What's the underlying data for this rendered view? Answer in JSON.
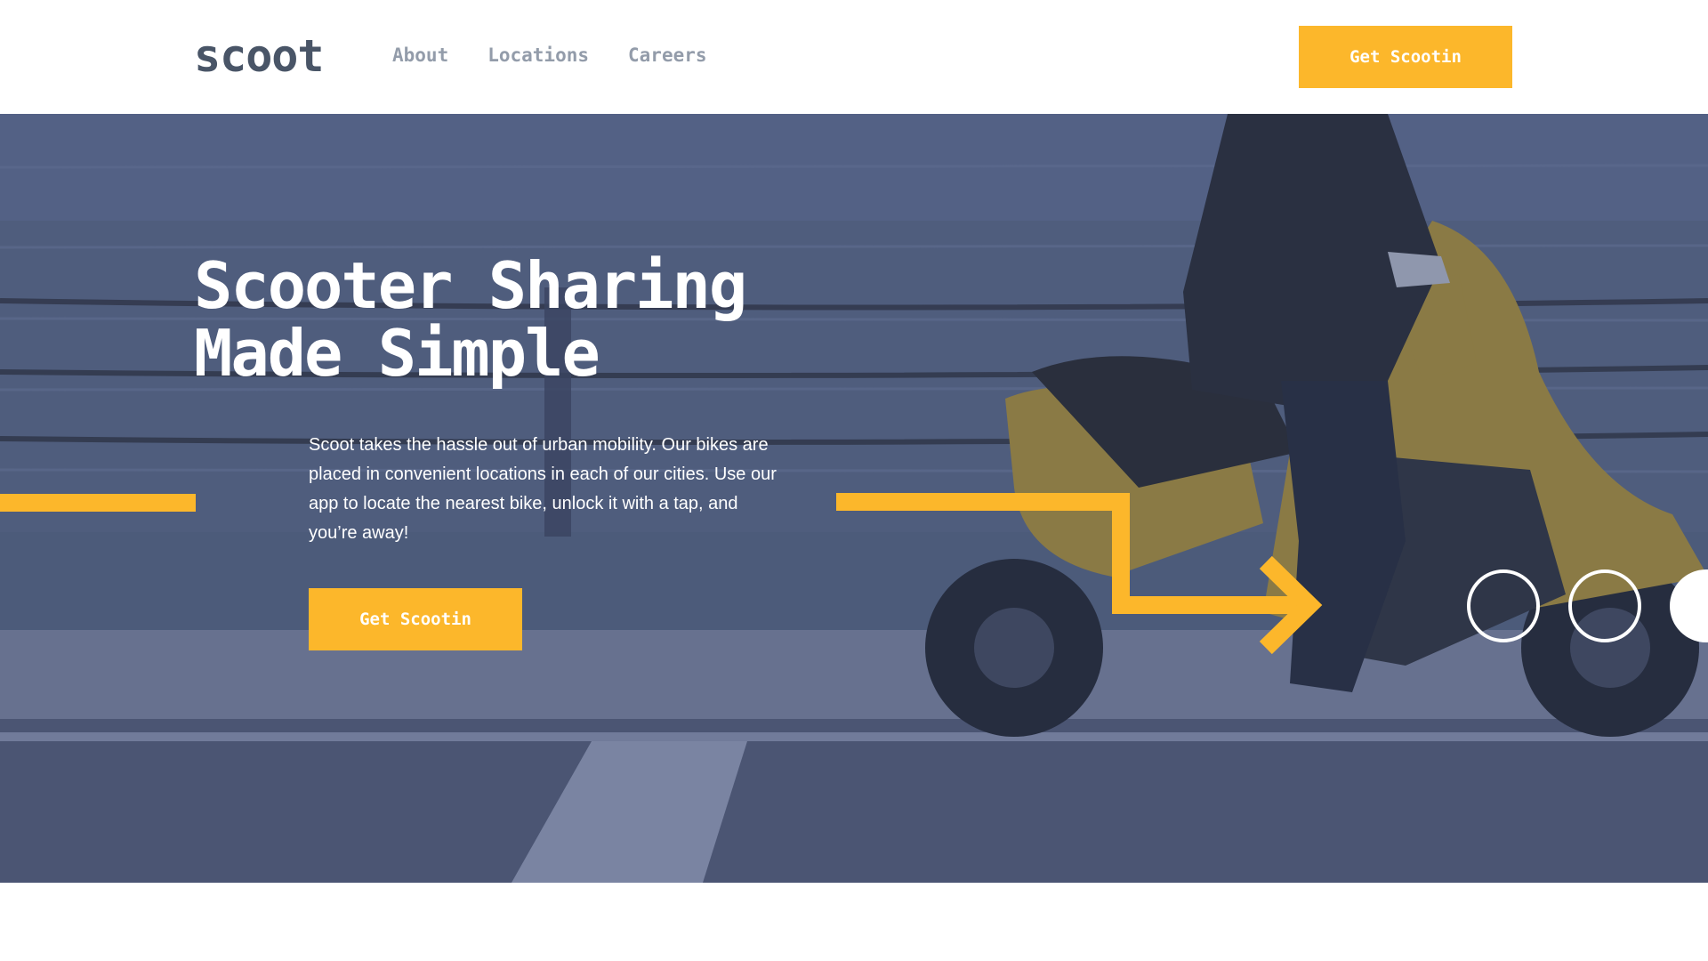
{
  "header": {
    "logo": "scoot",
    "nav": [
      "About",
      "Locations",
      "Careers"
    ],
    "cta": "Get Scootin"
  },
  "hero": {
    "title_line1": "Scooter Sharing",
    "title_line2": "Made Simple",
    "text": "Scoot takes the hassle out of urban mobility. Our bikes are placed in convenient locations in each of our cities. Use our app to locate the nearest bike, unlock it with a tap, and you’re away!",
    "cta": "Get Scootin"
  },
  "colors": {
    "accent": "#fcb72b",
    "dark": "#495567",
    "nav": "#939caa",
    "hero_overlay": "#4c5b7a"
  }
}
